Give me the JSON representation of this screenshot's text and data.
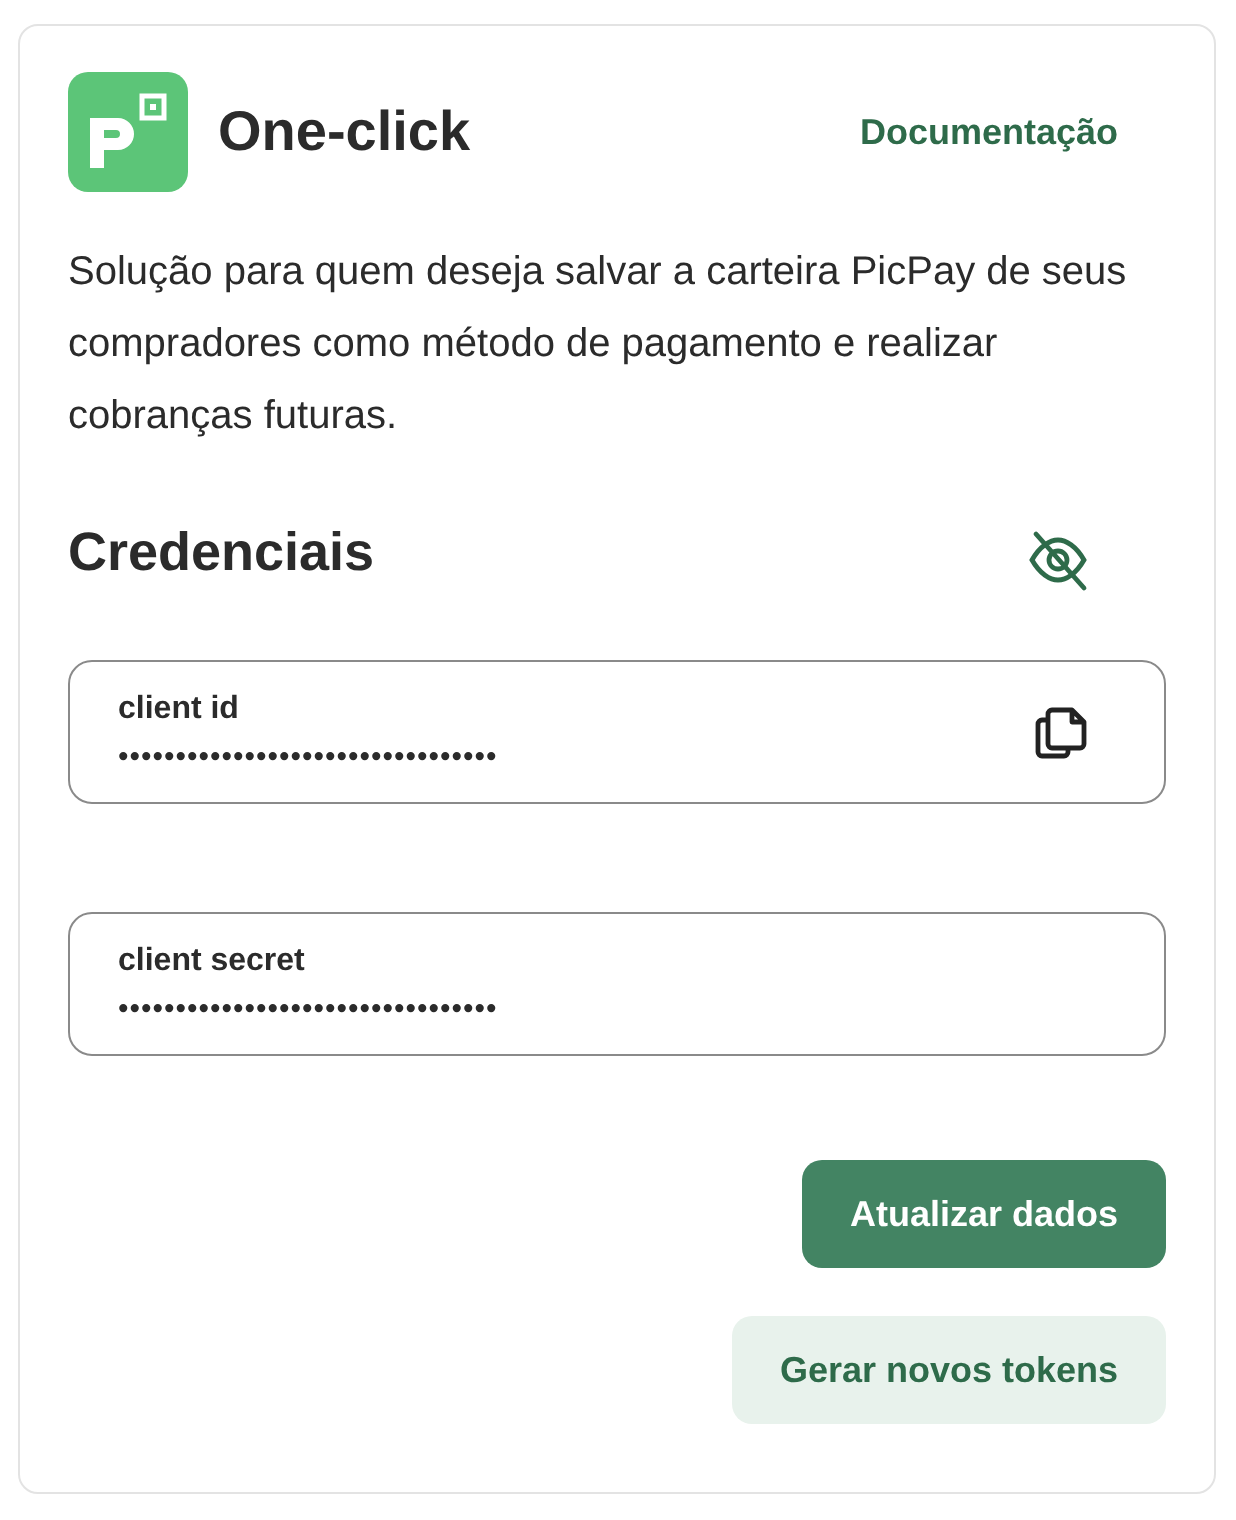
{
  "header": {
    "title": "One-click",
    "link": "Documentação"
  },
  "description": "Solução para quem deseja salvar a carteira PicPay de seus compradores como método de pagamento e realizar cobranças futuras.",
  "credentials": {
    "title": "Credenciais",
    "fields": [
      {
        "label": "client id",
        "value": "•••••••••••••••••••••••••••••••••",
        "kind": "copyable"
      },
      {
        "label": "client secret",
        "value": "•••••••••••••••••••••••••••••••••",
        "kind": "plain"
      }
    ]
  },
  "buttons": [
    {
      "label": "Atualizar dados",
      "kind": "primary"
    },
    {
      "label": "Gerar novos tokens",
      "kind": "secondary"
    }
  ]
}
